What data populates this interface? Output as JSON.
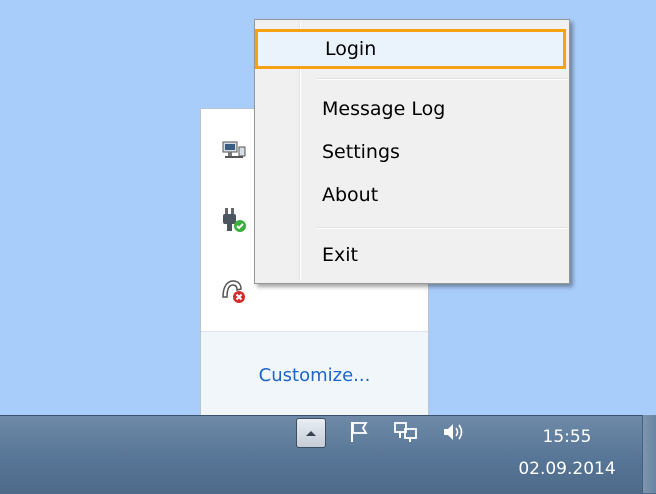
{
  "tray_panel": {
    "customize_label": "Customize...",
    "icons": [
      "network-adapter-icon",
      "usb-plug-status-icon",
      "phone-headset-error-icon"
    ]
  },
  "context_menu": {
    "items": [
      {
        "label": "Login",
        "highlighted": true
      },
      {
        "label": "Message Log"
      },
      {
        "label": "Settings"
      },
      {
        "label": "About"
      },
      {
        "label": "Exit"
      }
    ]
  },
  "taskbar": {
    "clock_time": "15:55",
    "clock_date": "02.09.2014",
    "icons": [
      "show-hidden-icons-button",
      "action-center-flag-icon",
      "network-icon",
      "volume-icon"
    ]
  },
  "colors": {
    "desktop": "#a9cdfb",
    "highlight_border": "#f5a315",
    "link": "#1b64c8"
  }
}
